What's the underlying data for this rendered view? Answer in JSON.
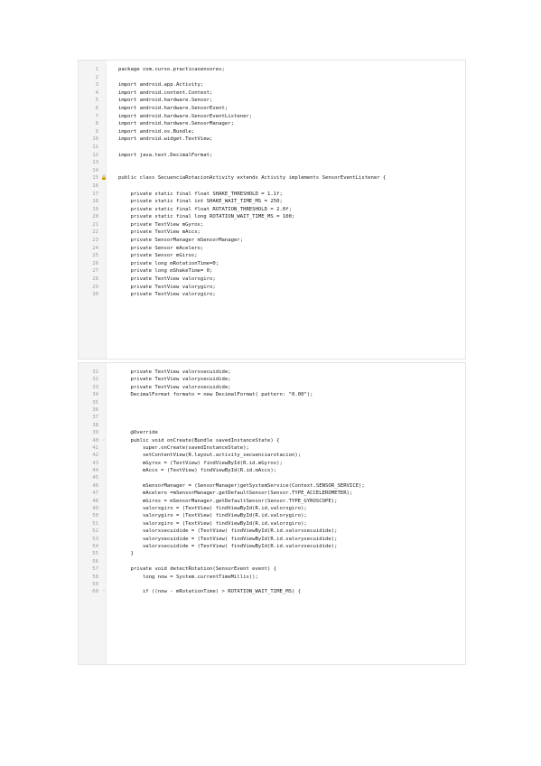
{
  "document": {
    "blocks": [
      {
        "id": "block1",
        "lines": [
          {
            "n": "1",
            "t": "package com.curso.practicasensores;"
          },
          {
            "n": "2",
            "t": ""
          },
          {
            "n": "3",
            "t": "import android.app.Activity;"
          },
          {
            "n": "4",
            "t": "import android.content.Context;"
          },
          {
            "n": "5",
            "t": "import android.hardware.Sensor;"
          },
          {
            "n": "6",
            "t": "import android.hardware.SensorEvent;"
          },
          {
            "n": "7",
            "t": "import android.hardware.SensorEventListener;"
          },
          {
            "n": "8",
            "t": "import android.hardware.SensorManager;"
          },
          {
            "n": "9",
            "t": "import android.os.Bundle;"
          },
          {
            "n": "10",
            "t": "import android.widget.TextView;"
          },
          {
            "n": "11",
            "t": ""
          },
          {
            "n": "12",
            "t": "import java.text.DecimalFormat;"
          },
          {
            "n": "13",
            "t": ""
          },
          {
            "n": "14",
            "t": ""
          },
          {
            "n": "15",
            "t": "public class SecuenciaRotacionActivity extends Activity implements SensorEventListener {",
            "m": "🔒"
          },
          {
            "n": "16",
            "t": ""
          },
          {
            "n": "17",
            "t": "    private static final float SHAKE_THRESHOLD = 1.1f;"
          },
          {
            "n": "18",
            "t": "    private static final int SHAKE_WAIT_TIME_MS = 250;"
          },
          {
            "n": "19",
            "t": "    private static final float ROTATION_THRESHOLD = 2.0f;"
          },
          {
            "n": "20",
            "t": "    private static final long ROTATION_WAIT_TIME_MS = 100;"
          },
          {
            "n": "21",
            "t": "    private TextView mGyrox;"
          },
          {
            "n": "22",
            "t": "    private TextView mAccx;"
          },
          {
            "n": "23",
            "t": "    private SensorManager mSensorManager;"
          },
          {
            "n": "24",
            "t": "    private Sensor mAcelero;"
          },
          {
            "n": "25",
            "t": "    private Sensor mGiros;"
          },
          {
            "n": "26",
            "t": "    private long mRotationTime=0;"
          },
          {
            "n": "27",
            "t": "    private long mShakeTime= 0;"
          },
          {
            "n": "28",
            "t": "    private TextView valorxgiro;"
          },
          {
            "n": "29",
            "t": "    private TextView valorygiro;"
          },
          {
            "n": "30",
            "t": "    private TextView valorzgiro;"
          }
        ]
      },
      {
        "id": "block2",
        "lines": [
          {
            "n": "31",
            "t": "    private TextView valorxsecuidide;"
          },
          {
            "n": "32",
            "t": "    private TextView valorysecuidide;"
          },
          {
            "n": "33",
            "t": "    private TextView valorzsecuidide;"
          },
          {
            "n": "34",
            "t": "    DecimalFormat formato = new DecimalFormat( pattern: \"0.00\");"
          },
          {
            "n": "35",
            "t": ""
          },
          {
            "n": "36",
            "t": ""
          },
          {
            "n": "37",
            "t": ""
          },
          {
            "n": "38",
            "t": ""
          },
          {
            "n": "39",
            "t": "    @Override"
          },
          {
            "n": "40",
            "t": "    public void onCreate(Bundle savedInstanceState) {",
            "m": "◦"
          },
          {
            "n": "41",
            "t": "        super.onCreate(savedInstanceState);"
          },
          {
            "n": "42",
            "t": "        setContentView(R.layout.activity_secuenciarotacion);"
          },
          {
            "n": "43",
            "t": "        mGyrox = (TextView) findViewById(R.id.mGyrox);"
          },
          {
            "n": "44",
            "t": "        mAccx = (TextView) findViewById(R.id.mAccx);"
          },
          {
            "n": "45",
            "t": ""
          },
          {
            "n": "46",
            "t": "        mSensorManager = (SensorManager)getSystemService(Context.SENSOR_SERVICE);"
          },
          {
            "n": "47",
            "t": "        mAcelero =mSensorManager.getDefaultSensor(Sensor.TYPE_ACCELEROMETER);"
          },
          {
            "n": "48",
            "t": "        mGiros = mSensorManager.getDefaultSensor(Sensor.TYPE_GYROSCOPE);"
          },
          {
            "n": "49",
            "t": "        valorxgiro = (TextView) findViewById(R.id.valorxgiro);"
          },
          {
            "n": "50",
            "t": "        valorygiro = (TextView) findViewById(R.id.valorygiro);"
          },
          {
            "n": "51",
            "t": "        valorzgiro = (TextView) findViewById(R.id.valorzgiro);"
          },
          {
            "n": "52",
            "t": "        valorxsecuidide = (TextView) findViewById(R.id.valorxsecuidide);"
          },
          {
            "n": "53",
            "t": "        valorysecuidide = (TextView) findViewById(R.id.valorysecuidide);"
          },
          {
            "n": "54",
            "t": "        valorzsecuidide = (TextView) findViewById(R.id.valorzsecuidide);"
          },
          {
            "n": "55",
            "t": "    }"
          },
          {
            "n": "56",
            "t": ""
          },
          {
            "n": "57",
            "t": "    private void detectRotation(SensorEvent event) {"
          },
          {
            "n": "58",
            "t": "        long now = System.currentTimeMillis();"
          },
          {
            "n": "59",
            "t": ""
          },
          {
            "n": "60",
            "t": "        if ((now - mRotationTime) > ROTATION_WAIT_TIME_MS) {",
            "m": "◦"
          }
        ]
      }
    ]
  }
}
